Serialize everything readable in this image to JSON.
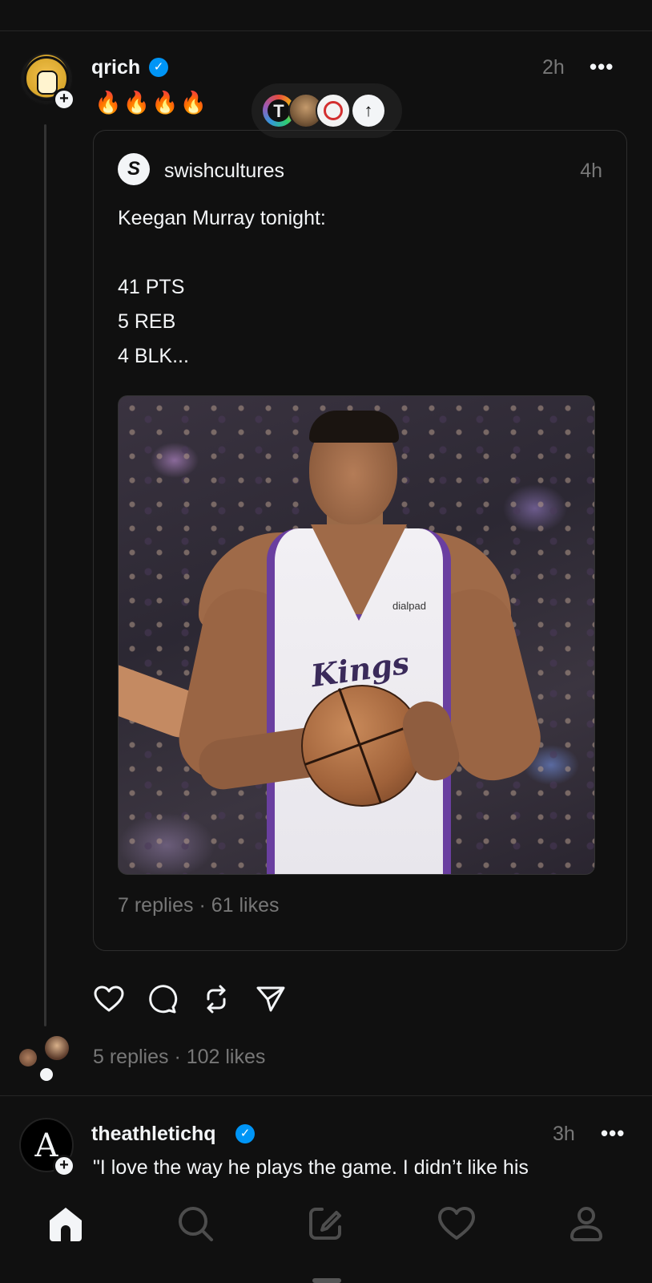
{
  "post1": {
    "username": "qrich",
    "verified": true,
    "time": "2h",
    "more": "•••",
    "text": "🔥🔥🔥🔥",
    "plus": "+",
    "upvote_icon": "arrow-up-icon",
    "quote": {
      "username": "swishcultures",
      "logo_letter": "S",
      "time": "4h",
      "lines": [
        "Keegan Murray tonight:",
        "",
        "41 PTS",
        "5 REB",
        "4 BLK..."
      ],
      "image_jersey_text": "Kings",
      "image_sponsor_text": "dialpad",
      "stats": "7 replies · 61 likes"
    },
    "actions": [
      "heart-icon",
      "comment-icon",
      "repost-icon",
      "share-icon"
    ],
    "stats": "5 replies · 102 likes"
  },
  "post2": {
    "username": "theathletichq",
    "verified": true,
    "time": "3h",
    "more": "•••",
    "avatar_letter": "A",
    "plus": "+",
    "text": "\"I love the way he plays the game. I didn’t like his"
  },
  "nav": [
    "home-icon",
    "search-icon",
    "compose-icon",
    "activity-heart-icon",
    "profile-icon"
  ],
  "colors": {
    "background": "#101010",
    "text": "#f3f5f7",
    "muted": "#777777",
    "verified": "#0095f6",
    "kings_purple": "#6a3fa0"
  }
}
